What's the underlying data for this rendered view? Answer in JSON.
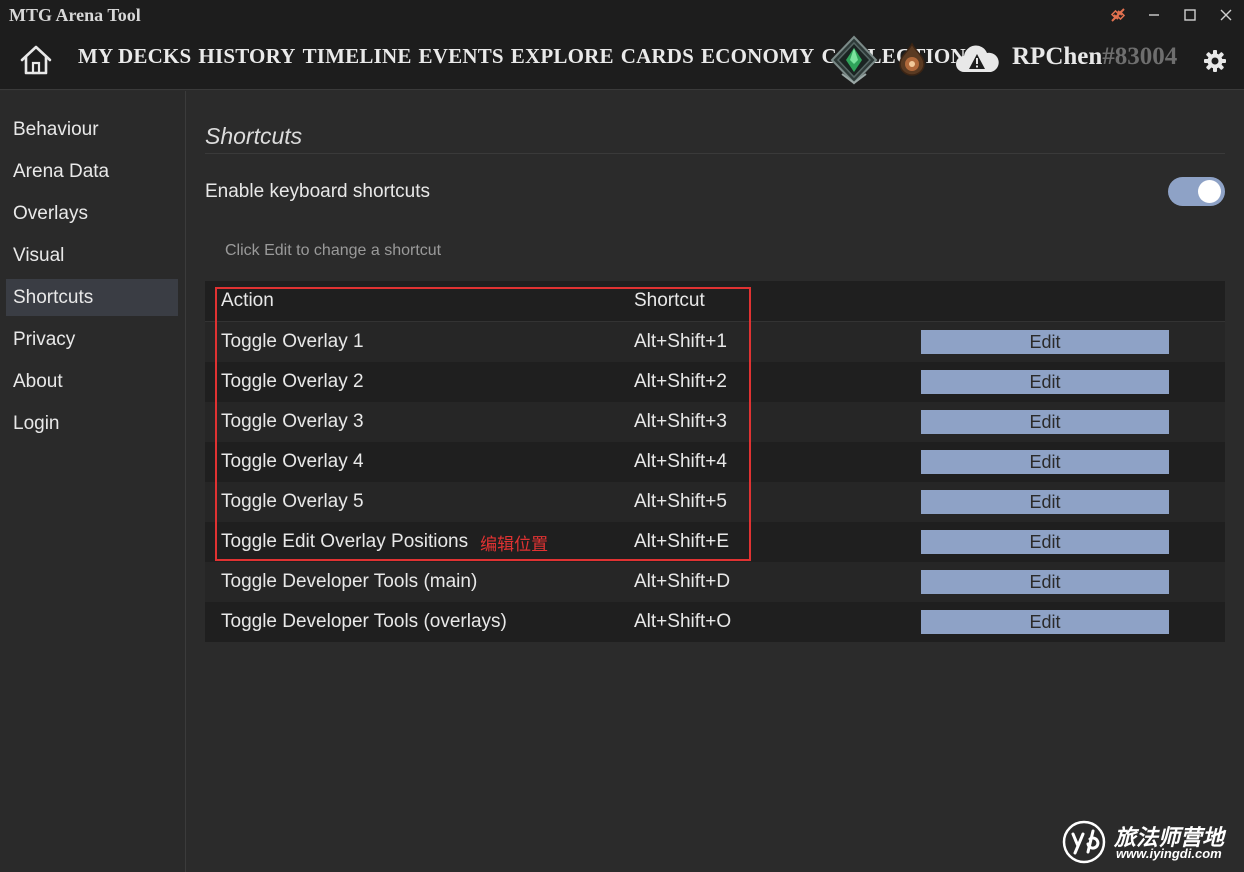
{
  "window": {
    "title": "MTG Arena Tool",
    "controls": [
      "disconnect-icon",
      "minimize-icon",
      "maximize-icon",
      "close-icon"
    ]
  },
  "nav": {
    "items": [
      "MY DECKS",
      "HISTORY",
      "TIMELINE",
      "EVENTS",
      "EXPLORE",
      "CARDS",
      "ECONOMY",
      "COLLECTION"
    ],
    "user_name": "RPChen",
    "user_tag": "#83004",
    "icons": [
      "home-icon",
      "rank-emerald-icon",
      "mana-icon",
      "cloud-warning-icon",
      "gear-icon"
    ]
  },
  "sidebar": {
    "items": [
      {
        "label": "Behaviour"
      },
      {
        "label": "Arena Data"
      },
      {
        "label": "Overlays"
      },
      {
        "label": "Visual"
      },
      {
        "label": "Shortcuts",
        "active": true
      },
      {
        "label": "Privacy"
      },
      {
        "label": "About"
      },
      {
        "label": "Login"
      }
    ]
  },
  "main": {
    "title": "Shortcuts",
    "enable_label": "Enable keyboard shortcuts",
    "enable_value": true,
    "hint": "Click Edit to change a shortcut",
    "table": {
      "headers": {
        "action": "Action",
        "shortcut": "Shortcut"
      },
      "edit_label": "Edit",
      "rows": [
        {
          "action": "Toggle Overlay 1",
          "shortcut": "Alt+Shift+1"
        },
        {
          "action": "Toggle Overlay 2",
          "shortcut": "Alt+Shift+2"
        },
        {
          "action": "Toggle Overlay 3",
          "shortcut": "Alt+Shift+3"
        },
        {
          "action": "Toggle Overlay 4",
          "shortcut": "Alt+Shift+4"
        },
        {
          "action": "Toggle Overlay 5",
          "shortcut": "Alt+Shift+5"
        },
        {
          "action": "Toggle Edit Overlay Positions",
          "shortcut": "Alt+Shift+E",
          "annotation": "编辑位置"
        },
        {
          "action": "Toggle Developer Tools (main)",
          "shortcut": "Alt+Shift+D"
        },
        {
          "action": "Toggle Developer Tools (overlays)",
          "shortcut": "Alt+Shift+O"
        }
      ]
    }
  },
  "watermark": {
    "title": "旅法师营地",
    "url": "www.iyingdi.com"
  },
  "colors": {
    "background": "#2b2b2b",
    "titlebar": "#1d1d1d",
    "accent": "#8ea2c6",
    "annotation": "#e03232",
    "active_item": "#3a3d44"
  }
}
